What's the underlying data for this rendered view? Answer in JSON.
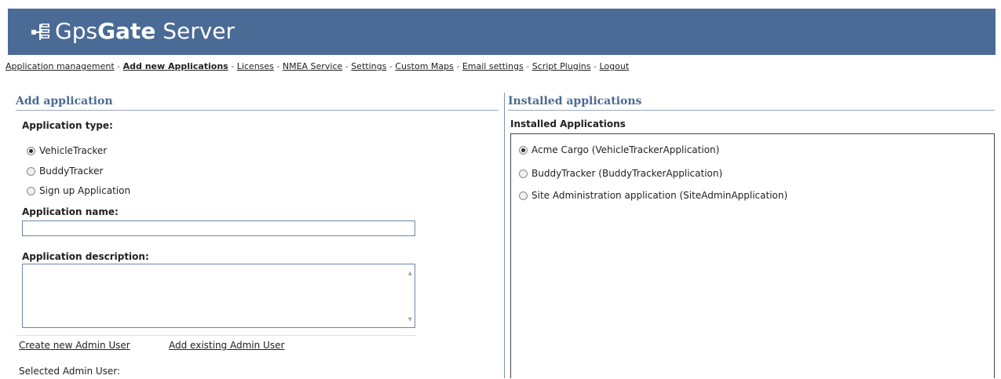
{
  "header": {
    "logo_text_regular": "Gps",
    "logo_text_bold": "Gate",
    "logo_text_suffix": " Server",
    "background_color": "#4a6b95"
  },
  "nav": {
    "items": [
      {
        "label": "Application management",
        "active": false
      },
      {
        "label": "Add new Applications",
        "active": true
      },
      {
        "label": "Licenses",
        "active": false
      },
      {
        "label": "NMEA Service",
        "active": false
      },
      {
        "label": "Settings",
        "active": false
      },
      {
        "label": "Custom Maps",
        "active": false
      },
      {
        "label": "Email settings",
        "active": false
      },
      {
        "label": "Script Plugins",
        "active": false
      },
      {
        "label": "Logout",
        "active": false
      }
    ],
    "separator": " - "
  },
  "add_app": {
    "title": "Add application",
    "type_label": "Application type:",
    "types": [
      {
        "label": "VehicleTracker",
        "checked": true
      },
      {
        "label": "BuddyTracker",
        "checked": false
      },
      {
        "label": "Sign up Application",
        "checked": false
      }
    ],
    "name_label": "Application name:",
    "name_value": "",
    "description_label": "Application description:",
    "description_value": "",
    "create_admin_link": "Create new Admin User",
    "add_admin_link": "Add existing Admin User",
    "selected_admin_label": "Selected Admin User:"
  },
  "installed": {
    "title": "Installed applications",
    "subtitle": "Installed Applications",
    "apps": [
      {
        "label": "Acme Cargo (VehicleTrackerApplication)",
        "checked": true
      },
      {
        "label": "BuddyTracker (BuddyTrackerApplication)",
        "checked": false
      },
      {
        "label": "Site Administration application (SiteAdminApplication)",
        "checked": false
      }
    ]
  }
}
